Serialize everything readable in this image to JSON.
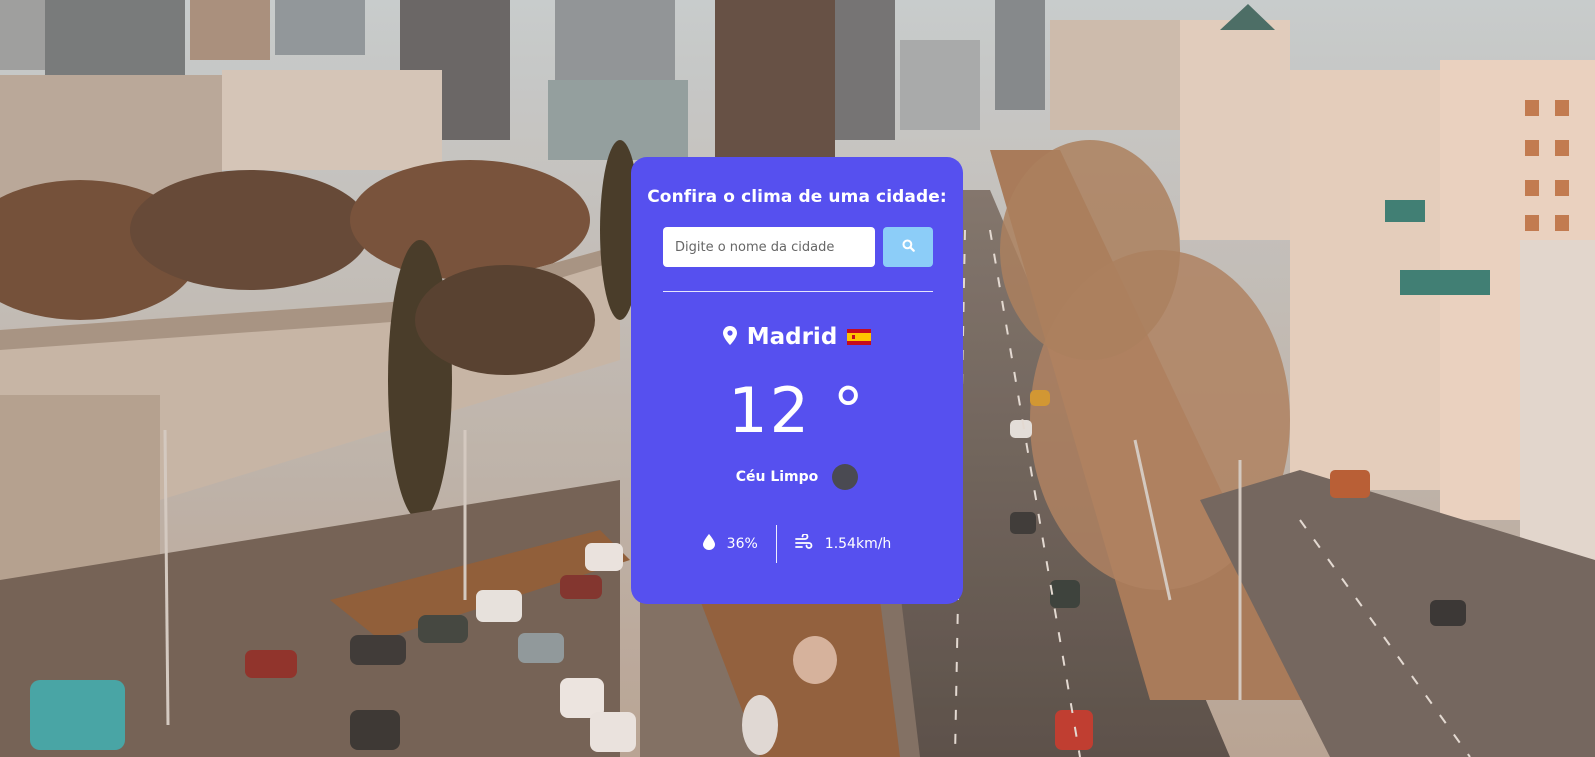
{
  "search": {
    "title": "Confira o clima de uma cidade:",
    "placeholder": "Digite o nome da cidade",
    "value": "",
    "button_icon": "search-icon"
  },
  "weather": {
    "city": "Madrid",
    "country_flag": "spain-flag-icon",
    "temperature": "12 °",
    "description": "Céu Limpo",
    "description_icon": "weather-icon",
    "humidity": "36%",
    "wind": "1.54km/h"
  },
  "colors": {
    "card_background": "#5650ef",
    "search_button": "#8ccdf8",
    "text": "#ffffff"
  }
}
